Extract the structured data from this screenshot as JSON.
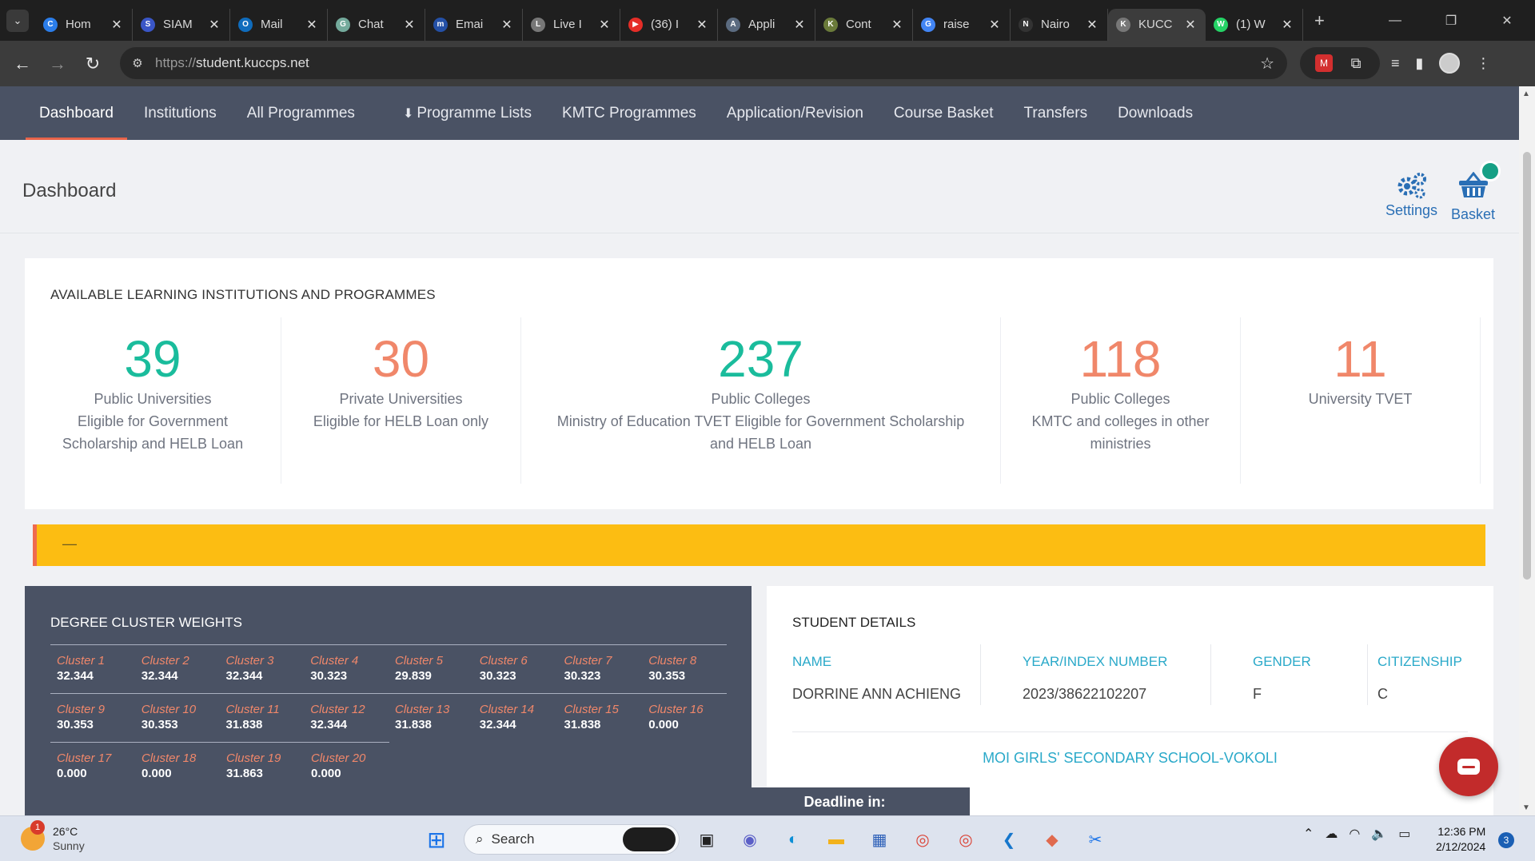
{
  "browser": {
    "tabs": [
      {
        "label": "Hom",
        "color": "#2b7de9",
        "glyph": "C"
      },
      {
        "label": "SIAM",
        "color": "#3a56c7",
        "glyph": "S"
      },
      {
        "label": "Mail",
        "color": "#0f6cbd",
        "glyph": "O"
      },
      {
        "label": "Chat",
        "color": "#74aa9c",
        "glyph": "G"
      },
      {
        "label": "Emai",
        "color": "#2450a6",
        "glyph": "m"
      },
      {
        "label": "Live I",
        "color": "#777777",
        "glyph": "L"
      },
      {
        "label": "(36) I",
        "color": "#e52d27",
        "glyph": "▶"
      },
      {
        "label": "Appli",
        "color": "#5b6b80",
        "glyph": "A"
      },
      {
        "label": "Cont",
        "color": "#6a7a3a",
        "glyph": "K"
      },
      {
        "label": "raise",
        "color": "#4285f4",
        "glyph": "G"
      },
      {
        "label": "Nairo",
        "color": "#333333",
        "glyph": "N"
      },
      {
        "label": "KUCC",
        "color": "#777777",
        "glyph": "K"
      },
      {
        "label": "(1) W",
        "color": "#25d366",
        "glyph": "W"
      }
    ],
    "active_tab": 11,
    "url_prefix": "https://",
    "url_host": "student.kuccps.net"
  },
  "nav": {
    "items": [
      "Dashboard",
      "Institutions",
      "All Programmes",
      "Programme Lists",
      "KMTC Programmes",
      "Application/Revision",
      "Course Basket",
      "Transfers",
      "Downloads"
    ],
    "active": "Dashboard"
  },
  "header": {
    "title": "Dashboard",
    "settings_label": "Settings",
    "basket_label": "Basket",
    "accent_color": "#2a6fb5"
  },
  "stats": {
    "heading": "AVAILABLE LEARNING INSTITUTIONS AND PROGRAMMES",
    "items": [
      {
        "number": "39",
        "lines": [
          "Public Universities",
          "Eligible for Government",
          "Scholarship and HELB Loan"
        ]
      },
      {
        "number": "30",
        "lines": [
          "Private Universities",
          "Eligible for HELB Loan only"
        ]
      },
      {
        "number": "237",
        "lines": [
          "Public Colleges",
          "Ministry of Education TVET Eligible for Government Scholarship",
          "and HELB Loan"
        ]
      },
      {
        "number": "118",
        "lines": [
          "Public Colleges",
          "KMTC and colleges in other",
          "ministries"
        ]
      },
      {
        "number": "11",
        "lines": [
          "University TVET"
        ]
      }
    ]
  },
  "alert": {
    "text": "—"
  },
  "clusters": {
    "title": "DEGREE CLUSTER WEIGHTS",
    "items": [
      {
        "name": "Cluster 1",
        "value": "32.344"
      },
      {
        "name": "Cluster 2",
        "value": "32.344"
      },
      {
        "name": "Cluster 3",
        "value": "32.344"
      },
      {
        "name": "Cluster 4",
        "value": "30.323"
      },
      {
        "name": "Cluster 5",
        "value": "29.839"
      },
      {
        "name": "Cluster 6",
        "value": "30.323"
      },
      {
        "name": "Cluster 7",
        "value": "30.323"
      },
      {
        "name": "Cluster 8",
        "value": "30.353"
      },
      {
        "name": "Cluster 9",
        "value": "30.353"
      },
      {
        "name": "Cluster 10",
        "value": "30.353"
      },
      {
        "name": "Cluster 11",
        "value": "31.838"
      },
      {
        "name": "Cluster 12",
        "value": "32.344"
      },
      {
        "name": "Cluster 13",
        "value": "31.838"
      },
      {
        "name": "Cluster 14",
        "value": "32.344"
      },
      {
        "name": "Cluster 15",
        "value": "31.838"
      },
      {
        "name": "Cluster 16",
        "value": "0.000"
      },
      {
        "name": "Cluster 17",
        "value": "0.000"
      },
      {
        "name": "Cluster 18",
        "value": "0.000"
      },
      {
        "name": "Cluster 19",
        "value": "31.863"
      },
      {
        "name": "Cluster 20",
        "value": "0.000"
      }
    ]
  },
  "student": {
    "title": "STUDENT DETAILS",
    "name_label": "NAME",
    "name": "DORRINE ANN ACHIENG",
    "index_label": "YEAR/INDEX NUMBER",
    "index": "2023/38622102207",
    "gender_label": "GENDER",
    "gender": "F",
    "citizenship_label": "CITIZENSHIP",
    "citizenship": "C",
    "school": "MOI GIRLS' SECONDARY SCHOOL-VOKOLI"
  },
  "deadline": {
    "label": "Deadline in:"
  },
  "taskbar": {
    "temperature": "26°C",
    "condition": "Sunny",
    "weather_badge": "1",
    "search_placeholder": "Search",
    "time": "12:36 PM",
    "date": "2/12/2024",
    "notifications": "3"
  }
}
